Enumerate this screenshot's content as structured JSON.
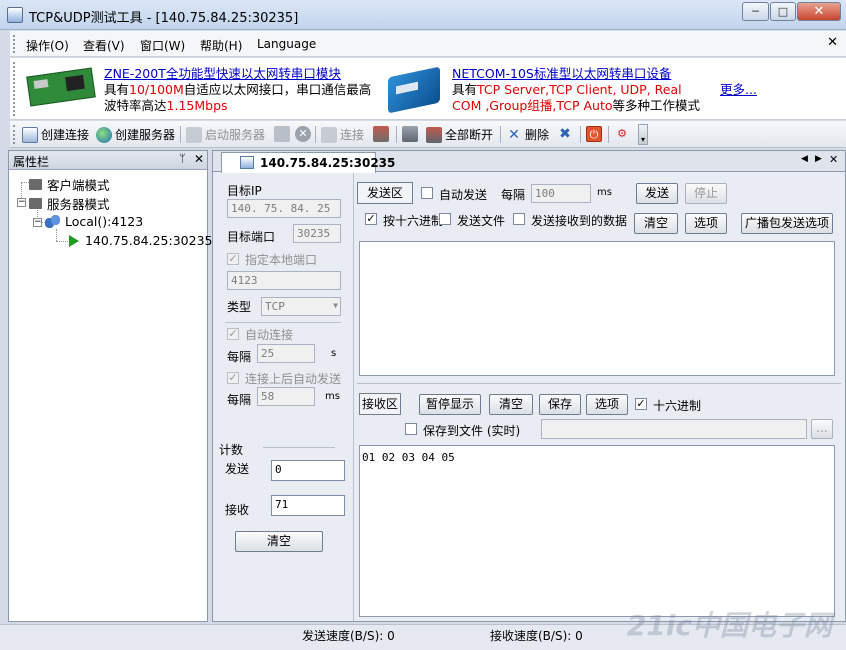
{
  "window": {
    "title": "TCP&UDP测试工具 - [140.75.84.25:30235]",
    "buttons": {
      "minimize": "─",
      "maximize": "□",
      "close": "✕"
    }
  },
  "menu": {
    "items": [
      "操作(O)",
      "查看(V)",
      "窗口(W)",
      "帮助(H)",
      "Language"
    ],
    "close": "✕"
  },
  "banner": {
    "ad1": {
      "link": "ZNE-200T全功能型快速以太网转串口模块",
      "line2_a": "具有",
      "line2_red": "10/100M",
      "line2_b": "自适应以太网接口，串口通信最高",
      "line3_a": "波特率高达",
      "line3_red": "1.15Mbps"
    },
    "ad2": {
      "link": "NETCOM-10S标准型以太网转串口设备",
      "line2_a": "具有",
      "line2_red": "TCP Server,TCP Client, UDP, Real",
      "line3_red": "COM ,Group组播,TCP Auto",
      "line3_b": "等多种工作模式"
    },
    "more": "更多..."
  },
  "toolbar": {
    "create_connection": "创建连接",
    "create_server": "创建服务器",
    "start_server": "启动服务器",
    "connect": "连接",
    "disconnect_all": "全部断开",
    "delete": "删除"
  },
  "left_panel": {
    "title": "属性栏",
    "pin": "ᛘ",
    "close": "✕",
    "tree": {
      "client_mode": "客户端模式",
      "server_mode": "服务器模式",
      "local": "Local():4123",
      "peer": "140.75.84.25:30235"
    }
  },
  "tab": {
    "label": "140.75.84.25:30235",
    "nav": {
      "prev": "◀",
      "next": "▶",
      "close": "✕"
    }
  },
  "settings": {
    "target_ip_label": "目标IP",
    "target_ip": "140. 75. 84. 25",
    "target_port_label": "目标端口",
    "target_port": "30235",
    "local_port_label": "指定本地端口",
    "local_port": "4123",
    "type_label": "类型",
    "type_value": "TCP",
    "auto_connect_label": "自动连接",
    "interval_label": "每隔",
    "interval1": "25",
    "unit_s": "s",
    "auto_send_label": "连接上后自动发送",
    "interval2": "58",
    "unit_ms": "ms",
    "count_label": "计数",
    "send_label": "发送",
    "send_count": "0",
    "recv_label": "接收",
    "recv_count": "71",
    "clear_button": "清空"
  },
  "send_area": {
    "title": "发送区",
    "auto_send": "自动发送",
    "interval_label": "每隔",
    "interval_value": "100",
    "unit": "ms",
    "send_button": "发送",
    "stop_button": "停止",
    "hex_label": "按十六进制",
    "send_file": "发送文件",
    "send_received": "发送接收到的数据",
    "clear_button": "清空",
    "options_button": "选项",
    "broadcast_button": "广播包发送选项"
  },
  "recv_area": {
    "title": "接收区",
    "pause_button": "暂停显示",
    "clear_button": "清空",
    "save_button": "保存",
    "options_button": "选项",
    "hex_label": "十六进制",
    "save_to_file": "保存到文件 (实时)",
    "browse_button": "...",
    "content": "01 02 03 04 05"
  },
  "statusbar": {
    "send_speed": "发送速度(B/S): 0",
    "recv_speed": "接收速度(B/S): 0"
  },
  "watermark": "21ic中国电子网"
}
